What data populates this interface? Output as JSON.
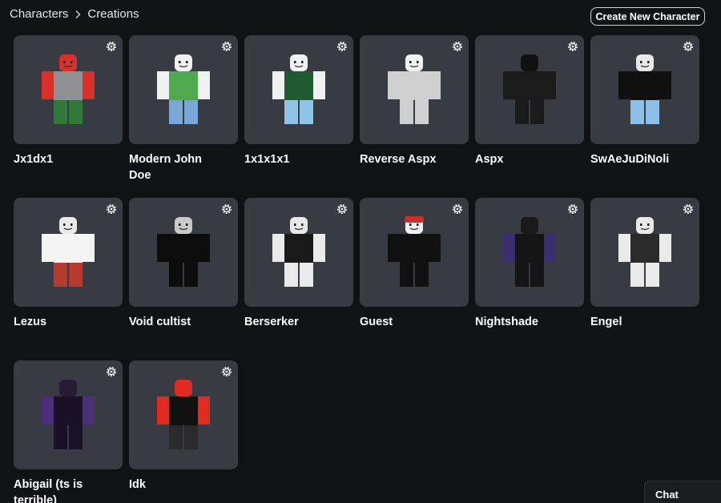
{
  "breadcrumb": {
    "parent": "Characters",
    "current": "Creations"
  },
  "header": {
    "create_label": "Create New Character"
  },
  "characters": [
    {
      "name": "Jx1dx1",
      "head": "#d9302a",
      "torso": "#8f9094",
      "arms": "#d9302a",
      "legs": "#2f7a38",
      "face": true
    },
    {
      "name": "Modern John Doe",
      "head": "#f1f1f1",
      "torso": "#4fa94f",
      "arms": "#f1f1f1",
      "legs": "#79a7d8",
      "face": true
    },
    {
      "name": "1x1x1x1",
      "head": "#f1f1f1",
      "torso": "#1f5a33",
      "arms": "#f1f1f1",
      "legs": "#8fc3e8",
      "face": true
    },
    {
      "name": "Reverse Aspx",
      "head": "#f1f1f1",
      "torso": "#cfcfcf",
      "arms": "#cfcfcf",
      "legs": "#cfcfcf",
      "face": true
    },
    {
      "name": "Aspx",
      "head": "#111111",
      "torso": "#1b1b1b",
      "arms": "#1b1b1b",
      "legs": "#1b1b1b",
      "face": false
    },
    {
      "name": "SwAeJuDiNoli",
      "head": "#e8e8e8",
      "torso": "#101010",
      "arms": "#101010",
      "legs": "#8cc0e8",
      "face": true
    },
    {
      "name": "Lezus",
      "head": "#eaeaea",
      "torso": "#f4f4f4",
      "arms": "#f4f4f4",
      "legs": "#b63a2d",
      "face": true
    },
    {
      "name": "Void cultist",
      "head": "#c9c9c9",
      "torso": "#0c0c0c",
      "arms": "#0c0c0c",
      "legs": "#0c0c0c",
      "face": true
    },
    {
      "name": "Berserker",
      "head": "#e9e9e9",
      "torso": "#1a1a1a",
      "arms": "#eaeaea",
      "legs": "#eaeaea",
      "face": true
    },
    {
      "name": "Guest",
      "head": "#f1f1f1",
      "torso": "#111111",
      "arms": "#111111",
      "legs": "#111111",
      "face": true,
      "hat": "#d22b2b"
    },
    {
      "name": "Nightshade",
      "head": "#1a1a1a",
      "torso": "#151515",
      "arms": "#3b2e6e",
      "legs": "#151515",
      "face": false
    },
    {
      "name": "Engel",
      "head": "#e9e9e9",
      "torso": "#2a2a2a",
      "arms": "#eaeaea",
      "legs": "#eaeaea",
      "face": true
    },
    {
      "name": "Abigail (ts is terrible)",
      "head": "#2a1a3a",
      "torso": "#1a1028",
      "arms": "#4c2f7a",
      "legs": "#1a1028",
      "face": false
    },
    {
      "name": "Idk",
      "head": "#e02b22",
      "torso": "#111111",
      "arms": "#e02b22",
      "legs": "#2a2a2a",
      "face": false
    }
  ],
  "chat": {
    "label": "Chat"
  }
}
